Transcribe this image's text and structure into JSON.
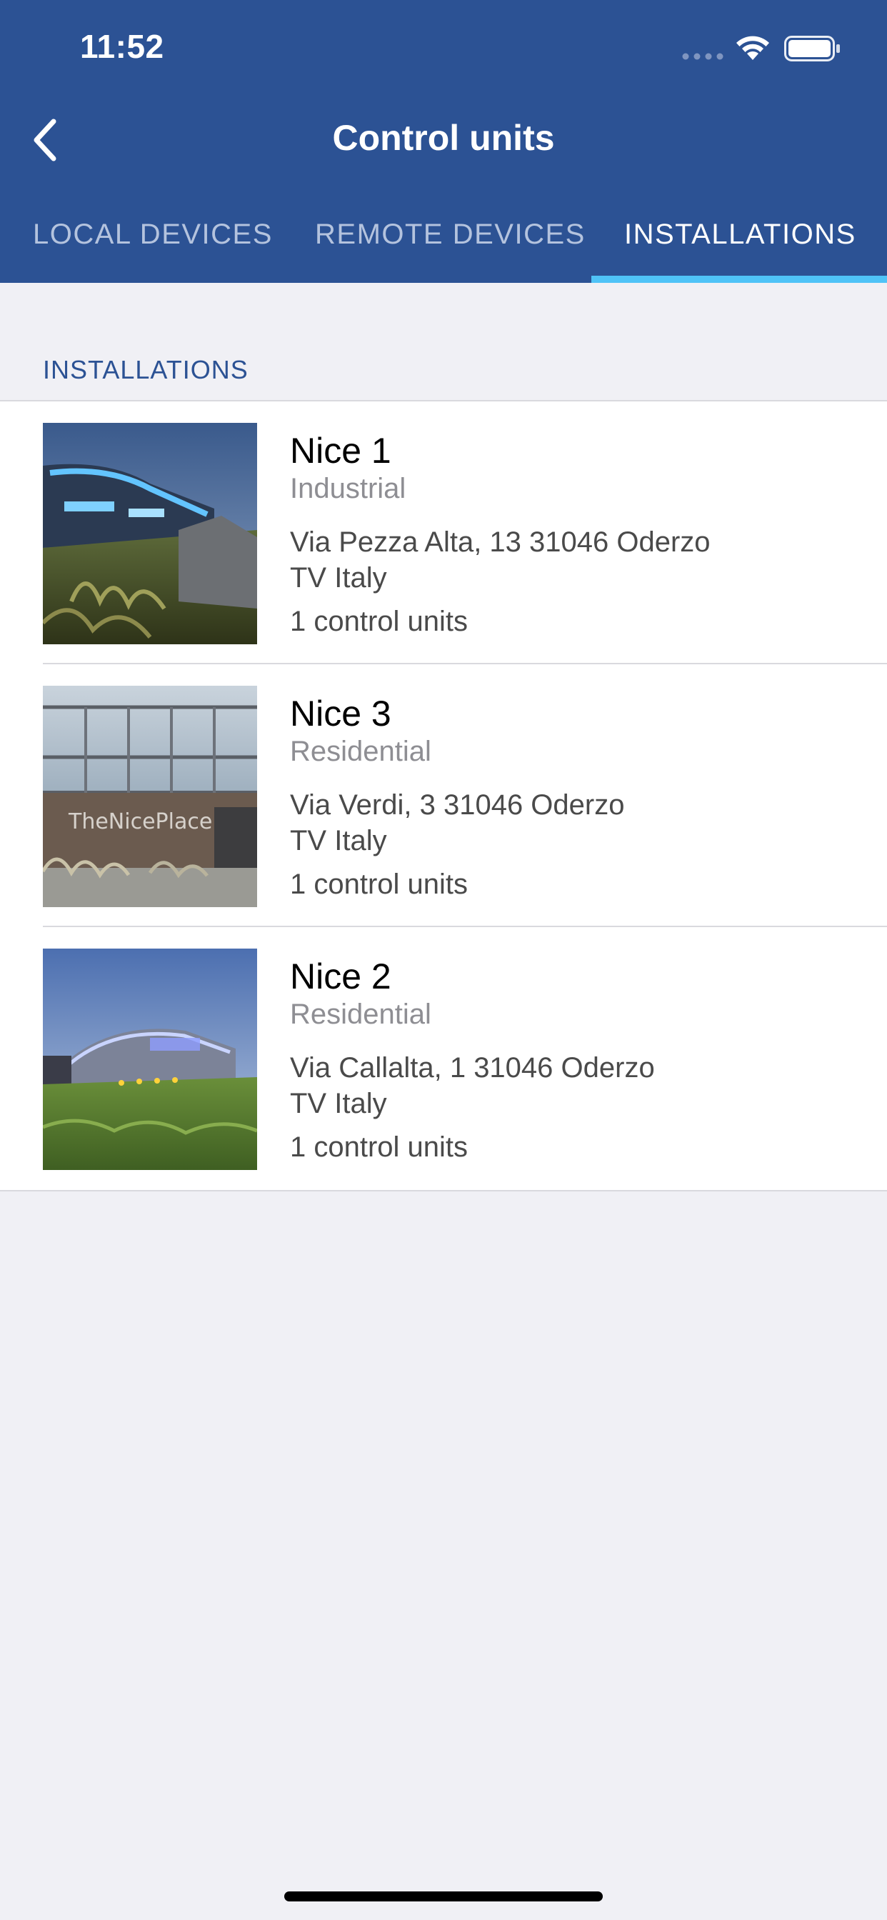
{
  "status_bar": {
    "time": "11:52"
  },
  "nav": {
    "title": "Control units",
    "back_icon": "chevron-left-icon"
  },
  "tabs": [
    {
      "label": "LOCAL DEVICES",
      "active": false
    },
    {
      "label": "REMOTE DEVICES",
      "active": false
    },
    {
      "label": "INSTALLATIONS",
      "active": true
    }
  ],
  "section": {
    "title": "INSTALLATIONS"
  },
  "installations": [
    {
      "name": "Nice 1",
      "type": "Industrial",
      "address_line1": "Via Pezza Alta, 13 31046 Oderzo",
      "address_line2": "TV Italy",
      "units": "1 control units"
    },
    {
      "name": "Nice 3",
      "type": "Residential",
      "address_line1": "Via Verdi, 3 31046 Oderzo",
      "address_line2": "TV Italy",
      "units": "1 control units",
      "image_text": "TheNicePlace"
    },
    {
      "name": "Nice 2",
      "type": "Residential",
      "address_line1": "Via Callalta, 1 31046 Oderzo",
      "address_line2": "TV Italy",
      "units": "1 control units"
    }
  ],
  "colors": {
    "header": "#2c5294",
    "tab_indicator": "#4fc3f7",
    "background": "#f0f0f5"
  }
}
